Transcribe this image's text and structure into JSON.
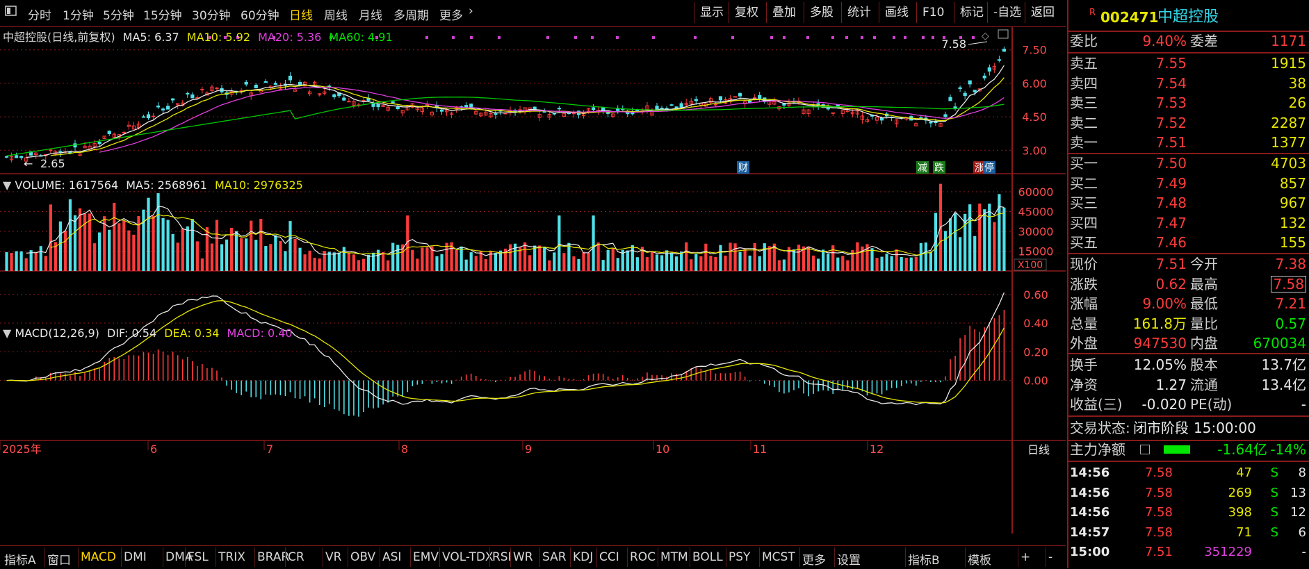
{
  "topbar": {
    "periods": [
      "分时",
      "1分钟",
      "5分钟",
      "15分钟",
      "30分钟",
      "60分钟",
      "日线",
      "周线",
      "月线",
      "多周期",
      "更多"
    ],
    "active_period": "日线",
    "tools": [
      "显示",
      "复权",
      "叠加",
      "多股",
      "统计",
      "画线",
      "F10",
      "标记",
      "-自选",
      "返回"
    ]
  },
  "price_panel": {
    "title": "中超控股(日线,前复权)",
    "ma5": "MA5: 6.37",
    "ma10": "MA10: 5.92",
    "ma20": "MA20: 5.36",
    "ma60": "MA60: 4.91",
    "yticks": [
      "7.50",
      "6.00",
      "4.50",
      "3.00"
    ],
    "high_label": "7.58",
    "low_label": "2.65",
    "badges": [
      "财",
      "减",
      "跌",
      "涨",
      "停"
    ]
  },
  "volume_panel": {
    "title": "VOLUME: 1617564",
    "ma5": "MA5: 2568961",
    "ma10": "MA10: 2976325",
    "yticks": [
      "60000",
      "45000",
      "30000",
      "15000"
    ],
    "unit": "X100"
  },
  "macd_panel": {
    "title": "MACD(12,26,9)",
    "dif": "DIF: 0.54",
    "dea": "DEA: 0.34",
    "macd": "MACD: 0.40",
    "yticks": [
      "0.60",
      "0.40",
      "0.20",
      "0.00"
    ]
  },
  "xaxis": {
    "labels": [
      "2025年",
      "6",
      "7",
      "8",
      "9",
      "10",
      "11",
      "12"
    ],
    "period_label": "日线"
  },
  "bottombar": {
    "items": [
      "指标A",
      "窗口",
      "MACD",
      "DMI",
      "DMA",
      "FSL",
      "TRIX",
      "BRAR",
      "CR",
      "VR",
      "OBV",
      "ASI",
      "EMV",
      "VOL-TDX",
      "RSI",
      "WR",
      "SAR",
      "KDJ",
      "CCI",
      "ROC",
      "MTM",
      "BOLL",
      "PSY",
      "MCST",
      "更多",
      "设置",
      "指标B",
      "模板",
      "+",
      "-"
    ],
    "active": "MACD"
  },
  "quote": {
    "badge": "R",
    "code": "002471",
    "name": "中超控股",
    "weibi_label": "委比",
    "weibi": "9.40%",
    "weicha_label": "委差",
    "weicha": "1171",
    "asks": [
      {
        "label": "卖五",
        "price": "7.55",
        "vol": "1915"
      },
      {
        "label": "卖四",
        "price": "7.54",
        "vol": "38"
      },
      {
        "label": "卖三",
        "price": "7.53",
        "vol": "26"
      },
      {
        "label": "卖二",
        "price": "7.52",
        "vol": "2287"
      },
      {
        "label": "卖一",
        "price": "7.51",
        "vol": "1377"
      }
    ],
    "bids": [
      {
        "label": "买一",
        "price": "7.50",
        "vol": "4703"
      },
      {
        "label": "买二",
        "price": "7.49",
        "vol": "857"
      },
      {
        "label": "买三",
        "price": "7.48",
        "vol": "967"
      },
      {
        "label": "买四",
        "price": "7.47",
        "vol": "132"
      },
      {
        "label": "买五",
        "price": "7.46",
        "vol": "155"
      }
    ],
    "stats": [
      {
        "l1": "现价",
        "v1": "7.51",
        "c1": "red",
        "l2": "今开",
        "v2": "7.38",
        "c2": "red"
      },
      {
        "l1": "涨跌",
        "v1": "0.62",
        "c1": "red",
        "l2": "最高",
        "v2": "7.58",
        "c2": "red"
      },
      {
        "l1": "涨幅",
        "v1": "9.00%",
        "c1": "red",
        "l2": "最低",
        "v2": "7.21",
        "c2": "red"
      },
      {
        "l1": "总量",
        "v1": "161.8万",
        "c1": "yel",
        "l2": "量比",
        "v2": "0.57",
        "c2": "green"
      },
      {
        "l1": "外盘",
        "v1": "947530",
        "c1": "red",
        "l2": "内盘",
        "v2": "670034",
        "c2": "green"
      }
    ],
    "stats2": [
      {
        "l1": "换手",
        "v1": "12.05%",
        "l2": "股本",
        "v2": "13.7亿"
      },
      {
        "l1": "净资",
        "v1": "1.27",
        "l2": "流通",
        "v2": "13.4亿"
      },
      {
        "l1": "收益(三)",
        "v1": "-0.020",
        "l2": "PE(动)",
        "v2": "-"
      }
    ],
    "trade_state_label": "交易状态:",
    "trade_state": "闭市阶段",
    "trade_time": "15:00:00",
    "mainflow_label": "主力净额",
    "mainflow": "-1.64亿",
    "mainflow_pct": "-14%",
    "ticks": [
      {
        "time": "14:56",
        "price": "7.58",
        "vol": "47",
        "side": "S",
        "n": "8"
      },
      {
        "time": "14:56",
        "price": "7.58",
        "vol": "269",
        "side": "S",
        "n": "13"
      },
      {
        "time": "14:56",
        "price": "7.58",
        "vol": "398",
        "side": "S",
        "n": "12"
      },
      {
        "time": "14:57",
        "price": "7.58",
        "vol": "71",
        "side": "S",
        "n": "6"
      },
      {
        "time": "15:00",
        "price": "7.51",
        "vol": "351229",
        "side": "",
        "n": "-"
      }
    ]
  },
  "colors": {
    "up": "#ff3b3b",
    "down": "#4fe0e8",
    "ma5": "#e8e8e8",
    "ma10": "#e6e600",
    "ma20": "#e040e0",
    "ma60": "#00c800",
    "grid": "#8b1a1a"
  }
}
